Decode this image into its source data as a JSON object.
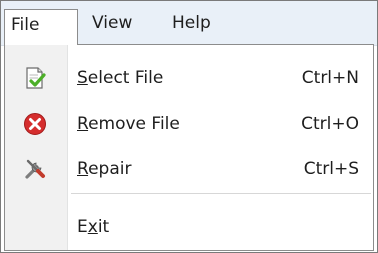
{
  "menubar": {
    "items": [
      {
        "label": "File"
      },
      {
        "label": "View"
      },
      {
        "label": "Help"
      }
    ]
  },
  "file_menu": {
    "items": [
      {
        "label_underlined": "S",
        "label_rest": "elect File",
        "shortcut": "Ctrl+N",
        "icon": "document-check-icon"
      },
      {
        "label_underlined": "R",
        "label_rest": "emove File",
        "shortcut": "Ctrl+O",
        "icon": "remove-x-icon"
      },
      {
        "label_underlined": "R",
        "label_rest": "epair",
        "shortcut": "Ctrl+S",
        "icon": "tools-icon"
      },
      {
        "label_start": "E",
        "label_underlined": "x",
        "label_rest": "it",
        "shortcut": ""
      }
    ]
  },
  "colors": {
    "menubar_bg": "#e9f0f8",
    "icon_strip_bg": "#f1f1f1",
    "remove_red": "#d52d2d",
    "check_green": "#4caf28"
  }
}
